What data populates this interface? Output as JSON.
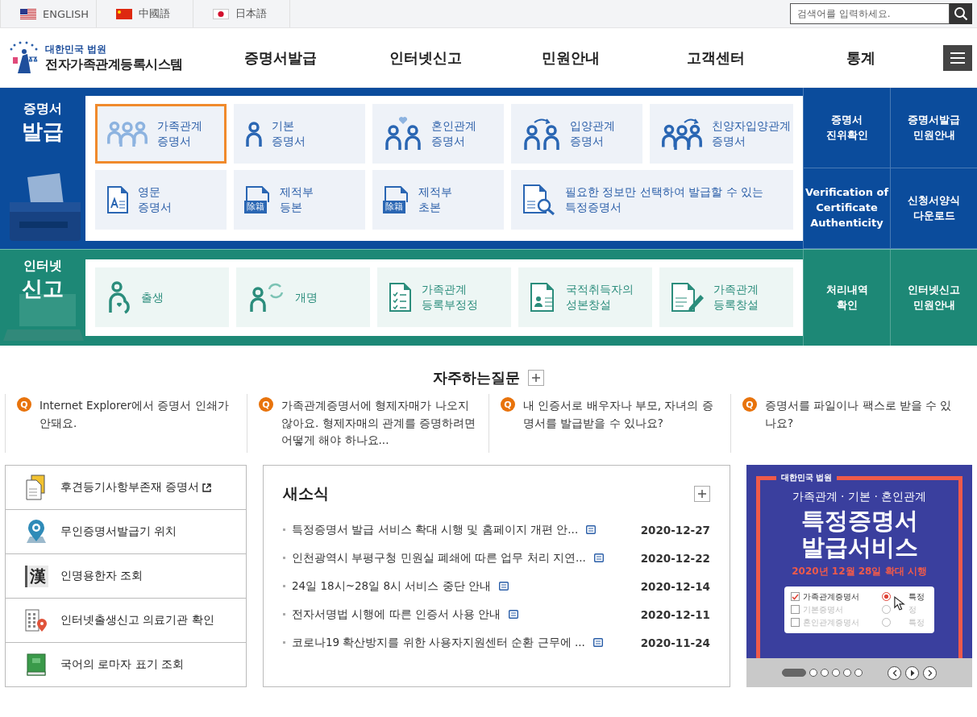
{
  "top_bar": {
    "languages": [
      {
        "label": "ENGLISH",
        "kind": "us"
      },
      {
        "label": "中國語",
        "kind": "cn"
      },
      {
        "label": "日本語",
        "kind": "jp"
      }
    ],
    "search": {
      "placeholder": "검색어를 입력하세요."
    }
  },
  "header": {
    "logo": {
      "org": "대한민국 법원",
      "system": "전자가족관계등록시스템"
    },
    "nav": [
      {
        "label": "증명서발급"
      },
      {
        "label": "인터넷신고"
      },
      {
        "label": "민원안내"
      },
      {
        "label": "고객센터"
      },
      {
        "label": "통계"
      }
    ]
  },
  "certificate_section": {
    "title": [
      "증명서",
      "발급"
    ],
    "items": [
      {
        "lines": [
          "가족관계",
          "증명서"
        ],
        "kind": "family",
        "selected": true
      },
      {
        "lines": [
          "기본",
          "증명서"
        ],
        "kind": "person",
        "selected": false
      },
      {
        "lines": [
          "혼인관계",
          "증명서"
        ],
        "kind": "couple",
        "selected": false
      },
      {
        "lines": [
          "입양관계",
          "증명서"
        ],
        "kind": "adopt",
        "selected": false
      },
      {
        "lines": [
          "친양자입양관계",
          "증명서"
        ],
        "kind": "family-adopt",
        "selected": false
      },
      {
        "lines": [
          "영문",
          "증명서"
        ],
        "kind": "doc-a",
        "selected": false
      },
      {
        "lines": [
          "제적부",
          "등본"
        ],
        "kind": "doc-text",
        "icon_text": "除籍",
        "selected": false
      },
      {
        "lines": [
          "제적부",
          "초본"
        ],
        "kind": "doc-text",
        "icon_text": "除籍",
        "selected": false
      },
      {
        "lines": [
          "필요한 정보만 선택하여 발급할 수 있는",
          "특정증명서"
        ],
        "kind": "doc-search",
        "wide": true,
        "selected": false
      }
    ],
    "side_links": [
      {
        "lines": [
          "증명서",
          "진위확인"
        ]
      },
      {
        "lines": [
          "증명서발급",
          "민원안내"
        ]
      },
      {
        "lines": [
          "Verification of",
          "Certificate",
          "Authenticity"
        ]
      },
      {
        "lines": [
          "신청서양식",
          "다운로드"
        ]
      }
    ]
  },
  "report_section": {
    "title": [
      "인터넷",
      "신고"
    ],
    "items": [
      {
        "lines": [
          "출생"
        ],
        "kind": "birth"
      },
      {
        "lines": [
          "개명"
        ],
        "kind": "rename"
      },
      {
        "lines": [
          "가족관계",
          "등록부정정"
        ],
        "kind": "checklist"
      },
      {
        "lines": [
          "국적취득자의",
          "성본창설"
        ],
        "kind": "id-doc"
      },
      {
        "lines": [
          "가족관계",
          "등록창설"
        ],
        "kind": "doc-pen"
      }
    ],
    "side_links": [
      {
        "lines": [
          "처리내역",
          "확인"
        ]
      },
      {
        "lines": [
          "인터넷신고",
          "민원안내"
        ]
      }
    ]
  },
  "faq": {
    "title": "자주하는질문",
    "items": [
      {
        "mark": "Q",
        "text": "Internet Explorer에서 증명서 인쇄가 안돼요."
      },
      {
        "mark": "Q",
        "text": "가족관계증명서에 형제자매가 나오지 않아요. 형제자매의 관계를 증명하려면 어떻게 해야 하나요..."
      },
      {
        "mark": "Q",
        "text": "내 인증서로 배우자나 부모, 자녀의 증명서를 발급받을 수 있나요?"
      },
      {
        "mark": "Q",
        "text": "증명서를 파일이나 팩스로 받을 수 있나요?"
      }
    ]
  },
  "quick_links": [
    {
      "label": "후견등기사항부존재 증명서",
      "kind": "docs",
      "external": true
    },
    {
      "label": "무인증명서발급기 위치",
      "kind": "pin",
      "external": false
    },
    {
      "label": "인명용한자 조회",
      "kind": "hanja",
      "icon_text": "漢",
      "external": false
    },
    {
      "label": "인터넷출생신고 의료기관 확인",
      "kind": "building",
      "external": false
    },
    {
      "label": "국어의 로마자 표기 조회",
      "kind": "book",
      "external": false
    }
  ],
  "news": {
    "title": "새소식",
    "items": [
      {
        "title": "특정증명서 발급 서비스 확대 시행 및 홈페이지 개편 안...",
        "date": "2020-12-27"
      },
      {
        "title": "인천광역시 부평구청 민원실 폐쇄에 따른 업무 처리 지연...",
        "date": "2020-12-22"
      },
      {
        "title": "24일 18시~28일 8시 서비스 중단 안내",
        "date": "2020-12-14"
      },
      {
        "title": "전자서명법 시행에 따른 인증서 사용 안내",
        "date": "2020-12-11"
      },
      {
        "title": "코로나19 확산방지를 위한 사용자지원센터 순환 근무에 ...",
        "date": "2020-11-24"
      }
    ]
  },
  "banner": {
    "org": "대한민국 법원",
    "subtitle": "가족관계 · 기본 · 혼인관계",
    "headline": [
      "특정증명서",
      "발급서비스"
    ],
    "date_line": "2020년 12월 28일 확대 시행",
    "options": [
      {
        "label": "가족관계증명서",
        "checked": true,
        "choice": "특정",
        "choice_selected": true
      },
      {
        "label": "기본증명서",
        "checked": false,
        "choice": "정",
        "choice_selected": false
      },
      {
        "label": "혼인관계증명서",
        "checked": false,
        "choice": "특정",
        "choice_selected": false
      }
    ],
    "slides": [
      {
        "selected": true
      },
      {
        "selected": false
      },
      {
        "selected": false
      },
      {
        "selected": false
      },
      {
        "selected": false
      },
      {
        "selected": false
      }
    ]
  }
}
